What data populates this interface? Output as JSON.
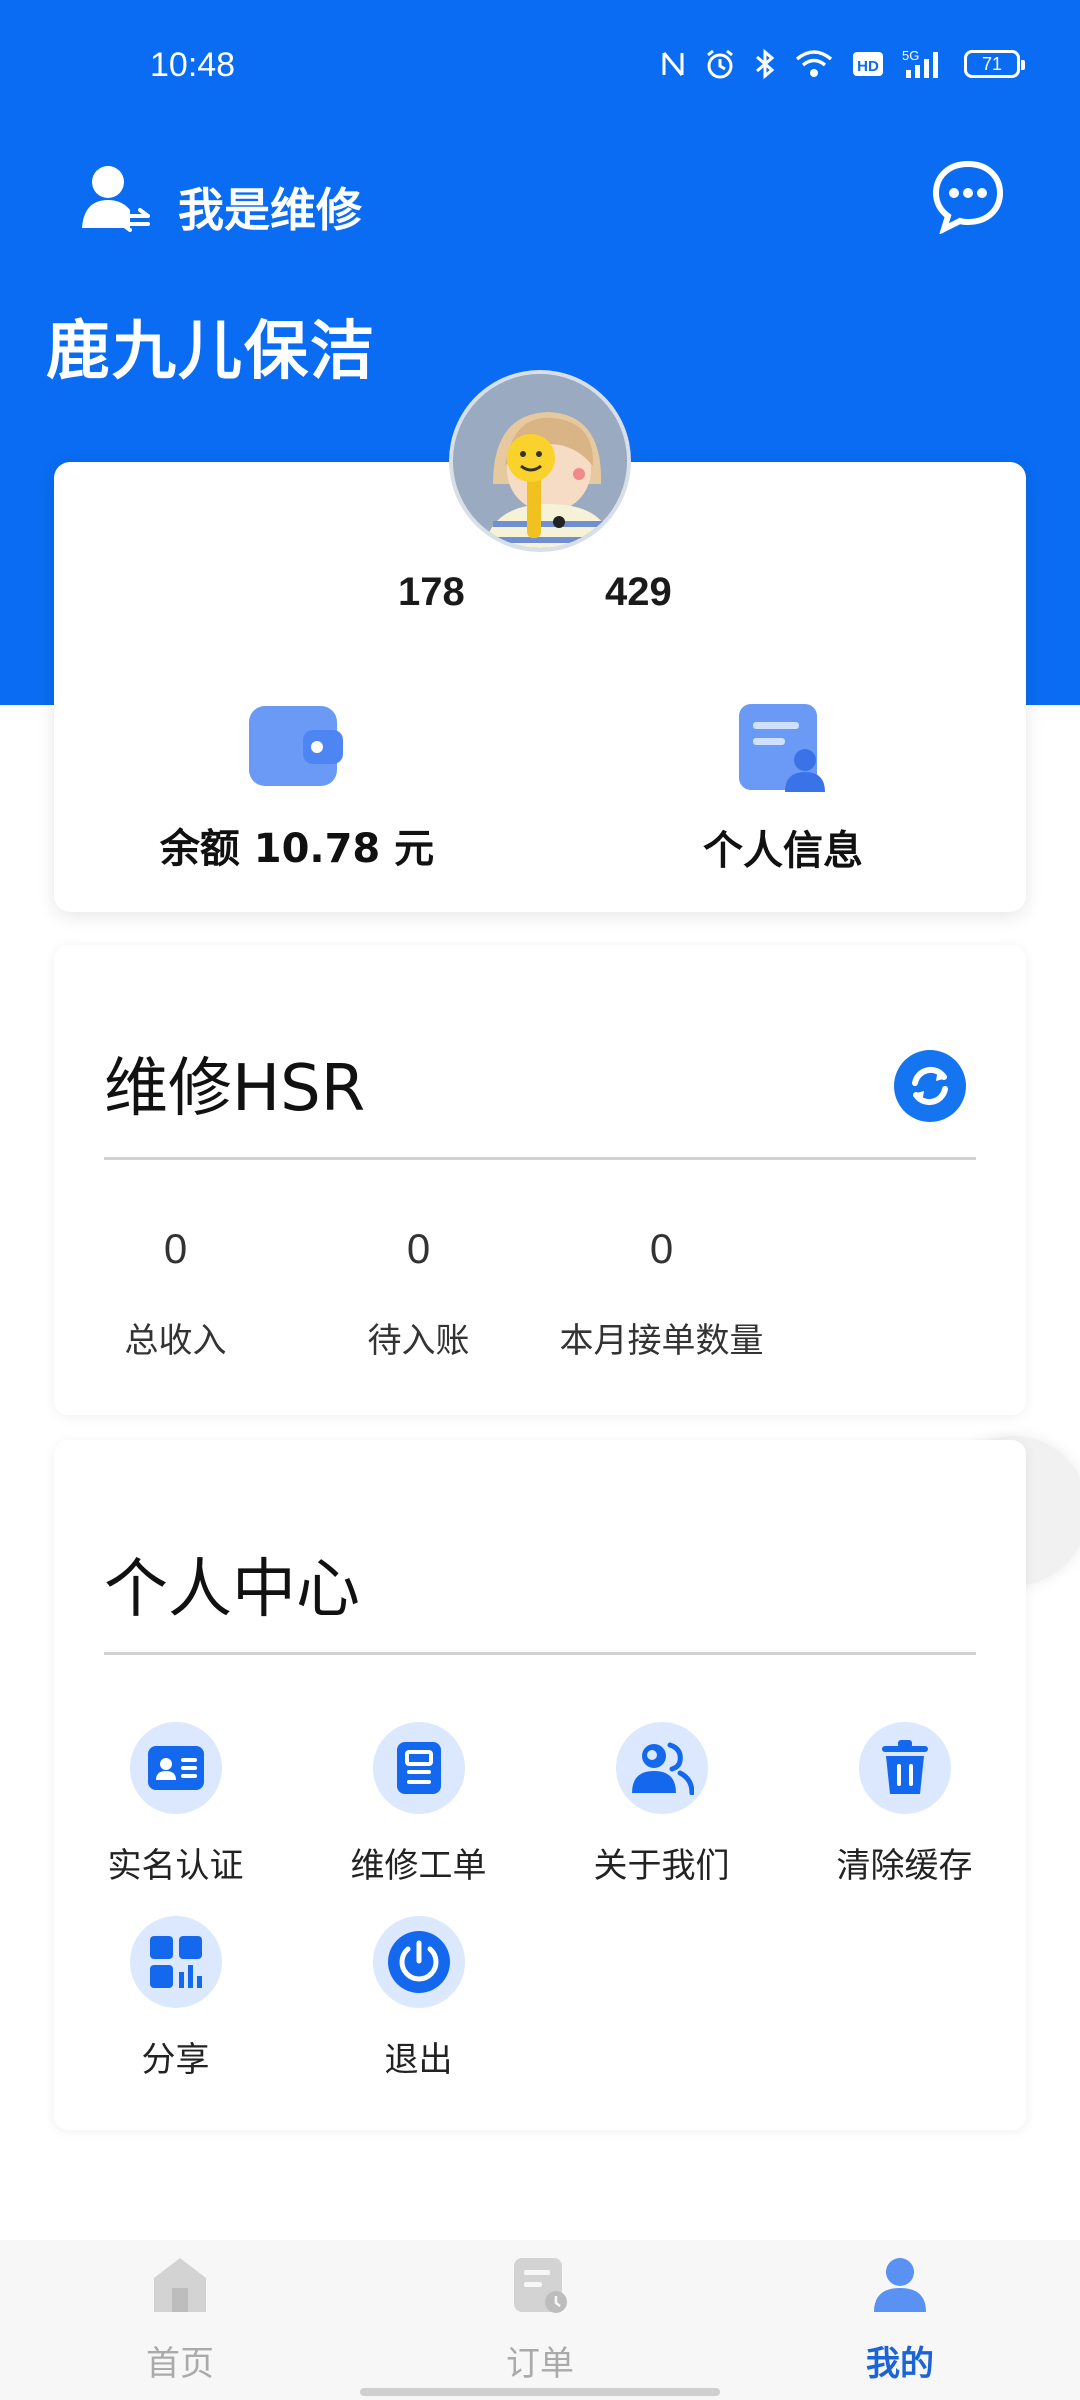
{
  "status_bar": {
    "time": "10:48",
    "battery": "71",
    "icons": [
      "nfc-icon",
      "alarm-icon",
      "bluetooth-icon",
      "wifi-icon",
      "hd-icon",
      "5g-signal-icon",
      "battery-icon"
    ]
  },
  "header": {
    "role_label": "我是维修",
    "shop_name": "鹿九儿保洁",
    "brand_color": "#0a6cf2"
  },
  "profile": {
    "stat_left": "178",
    "stat_right": "429",
    "balance_label": "余额 10.78 元",
    "info_label": "个人信息"
  },
  "hsr": {
    "title": "维修HSR",
    "stats": [
      {
        "value": "0",
        "label": "总收入"
      },
      {
        "value": "0",
        "label": "待入账"
      },
      {
        "value": "0",
        "label": "本月接单数量"
      }
    ]
  },
  "center": {
    "title": "个人中心",
    "items": [
      {
        "label": "实名认证",
        "icon": "id-card-icon"
      },
      {
        "label": "维修工单",
        "icon": "work-order-icon"
      },
      {
        "label": "关于我们",
        "icon": "users-icon"
      },
      {
        "label": "清除缓存",
        "icon": "trash-icon"
      },
      {
        "label": "分享",
        "icon": "share-grid-icon"
      },
      {
        "label": "退出",
        "icon": "power-icon"
      }
    ]
  },
  "bottom_nav": {
    "items": [
      {
        "label": "首页",
        "icon": "home-icon"
      },
      {
        "label": "订单",
        "icon": "order-icon"
      },
      {
        "label": "我的",
        "icon": "profile-icon"
      }
    ],
    "active": "我的"
  }
}
